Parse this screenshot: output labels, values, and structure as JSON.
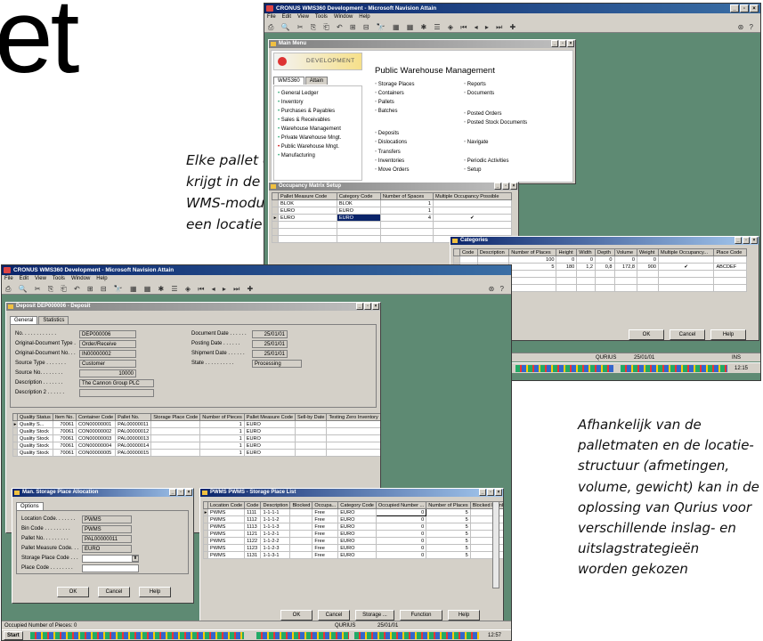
{
  "headline": "et",
  "caption_left": {
    "lines": [
      "Elke pallet en/of container",
      "krijgt in de aanvullende",
      "WMS-module automatisch",
      "een locatie toegewezen"
    ]
  },
  "caption_right": {
    "lines": [
      "Afhankelijk van de",
      "palletmaten en de locatie-",
      "structuur (afmetingen,",
      "volume, gewicht) kan in de",
      "oplossing van Qurius voor",
      "verschillende inslag- en",
      "uitslagstrategieën",
      "worden gekozen"
    ]
  },
  "app": {
    "title": "CRONUS WMS360 Development - Microsoft Navision Attain",
    "menu": [
      "File",
      "Edit",
      "View",
      "Tools",
      "Window",
      "Help"
    ],
    "toolbar_glyphs": "⎙ 🔍  ✂ ⎘ ⎗  ↶ ⊞ ⊟ 🔭 ▦ ▦ ✱ ☰  ◈  ⏮ ◂ ▸ ⏭ ✚",
    "toolbar_right": "⊛ ?"
  },
  "main_menu": {
    "title": "Main Menu",
    "banner": "DEVELOPMENT",
    "tabs": [
      "WMS360",
      "Attain"
    ],
    "nav": [
      "General Ledger",
      "Inventory",
      "Purchases & Payables",
      "Sales & Receivables",
      "Warehouse Management",
      "Private Warehouse Mngt.",
      "Public Warehouse Mngt.",
      "Manufacturing"
    ],
    "heading": "Public Warehouse Management",
    "col1": [
      "Storage Places",
      "Containers",
      "Pallets",
      "Batches",
      "Deposits",
      "Dislocations",
      "Transfers",
      "Inventories",
      "Move Orders"
    ],
    "col2": [
      "Reports",
      "Documents",
      "Posted Orders",
      "Posted Stock Documents",
      "Navigate",
      "Periodic Activities",
      "Setup"
    ]
  },
  "occupancy": {
    "title": "Occupancy Matrix Setup",
    "headers": [
      "Pallet Measure Code",
      "Category Code",
      "Number of Spaces",
      "Multiple Occupancy Possible"
    ],
    "rows": [
      [
        "BLOK",
        "BLOK",
        "1",
        ""
      ],
      [
        "EURO",
        "EURO",
        "1",
        ""
      ],
      [
        "EURO",
        "EURO",
        "4",
        "✔"
      ]
    ]
  },
  "categories": {
    "title": "Categories",
    "headers": [
      "Code",
      "Description",
      "Number of Places",
      "Height",
      "Width",
      "Depth",
      "Volume",
      "Weight",
      "Multiple Occupancy...",
      "Place Code"
    ],
    "rows": [
      [
        "",
        "",
        "100",
        "0",
        "0",
        "0",
        "0",
        "0",
        "",
        ""
      ],
      [
        "",
        "",
        "5",
        "180",
        "1,2",
        "0,8",
        "172,8",
        "900",
        "✔",
        "ABCDEF"
      ]
    ],
    "ok": "OK",
    "cancel": "Cancel",
    "help": "Help"
  },
  "back_status": {
    "company": "QURIUS",
    "date": "25/01/01",
    "ins": "INS",
    "clock": "12:15"
  },
  "deposit": {
    "title": "Deposit DEP000006 - Deposit",
    "tabs": [
      "General",
      "Statistics"
    ],
    "left_fields": [
      {
        "label": "No. . . . . . . . . . . .",
        "value": "DEP000006"
      },
      {
        "label": "Original-Document Type .",
        "value": "Order/Receive"
      },
      {
        "label": "Original-Document No. . .",
        "value": "IN00000002"
      },
      {
        "label": "Source Type . . . . . . .",
        "value": "Customer"
      },
      {
        "label": "Source No. . . . . . . .",
        "value": "10000"
      },
      {
        "label": "Description . . . . . . .",
        "value": "The Cannon Group PLC"
      },
      {
        "label": "Description 2 . . . . . .",
        "value": ""
      }
    ],
    "right_fields": [
      {
        "label": "Document Date . . . . . .",
        "value": "25/01/01"
      },
      {
        "label": "Posting Date . . . . . .",
        "value": "25/01/01"
      },
      {
        "label": "Shipment Date . . . . . .",
        "value": "25/01/01"
      },
      {
        "label": "State . . . . . . . . . .",
        "value": "Processing"
      }
    ],
    "line_headers": [
      "Quality Status",
      "Item No.",
      "Container Code",
      "Pallet No.",
      "Storage Place Code",
      "Number of Pieces",
      "Pallet Measure Code",
      "Sell-by Date",
      "Testing Zero Inventory"
    ],
    "lines": [
      [
        "Quality S...",
        "70061",
        "CON00000001",
        "PAL00000011",
        "",
        "1",
        "EURO",
        "",
        ""
      ],
      [
        "Quality Stock",
        "70061",
        "CON00000002",
        "PAL00000012",
        "",
        "1",
        "EURO",
        "",
        ""
      ],
      [
        "Quality Stock",
        "70061",
        "CON00000003",
        "PAL00000013",
        "",
        "1",
        "EURO",
        "",
        ""
      ],
      [
        "Quality Stock",
        "70061",
        "CON00000004",
        "PAL00000014",
        "",
        "1",
        "EURO",
        "",
        ""
      ],
      [
        "Quality Stock",
        "70061",
        "CON00000005",
        "PAL00000015",
        "",
        "1",
        "EURO",
        "",
        ""
      ]
    ]
  },
  "man_storage": {
    "title": "Man. Storage Place Allocation",
    "tab": "Options",
    "fields": [
      {
        "label": "Location Code. . . . . . .",
        "value": "PWMS"
      },
      {
        "label": "Bin Code . . . . . . . . .",
        "value": "PWMS"
      },
      {
        "label": "Pallet No. . . . . . . . .",
        "value": "PAL00000011"
      },
      {
        "label": "Pallet Measure Code. . .",
        "value": "EURO"
      },
      {
        "label": "Storage Place Code . . .",
        "value": ""
      },
      {
        "label": "Place Code . . . . . . . .",
        "value": ""
      }
    ],
    "ok": "OK",
    "cancel": "Cancel",
    "help": "Help"
  },
  "storage_list": {
    "title": "PWMS PWMS - Storage Place List",
    "headers": [
      "Location Code",
      "Code",
      "Description",
      "Blocked",
      "Occupa...",
      "Category Code",
      "Occupied Number ...",
      "Number of Places",
      "Blocked Number ..."
    ],
    "rows": [
      [
        "PWMS",
        "1111",
        "1-1-1-1",
        "",
        "Free",
        "EURO",
        "0",
        "5",
        ""
      ],
      [
        "PWMS",
        "1112",
        "1-1-1-2",
        "",
        "Free",
        "EURO",
        "0",
        "5",
        ""
      ],
      [
        "PWMS",
        "1113",
        "1-1-1-3",
        "",
        "Free",
        "EURO",
        "0",
        "5",
        ""
      ],
      [
        "PWMS",
        "1121",
        "1-1-2-1",
        "",
        "Free",
        "EURO",
        "0",
        "5",
        ""
      ],
      [
        "PWMS",
        "1122",
        "1-1-2-2",
        "",
        "Free",
        "EURO",
        "0",
        "5",
        ""
      ],
      [
        "PWMS",
        "1123",
        "1-1-2-3",
        "",
        "Free",
        "EURO",
        "0",
        "5",
        ""
      ],
      [
        "PWMS",
        "1131",
        "1-1-3-1",
        "",
        "Free",
        "EURO",
        "0",
        "5",
        ""
      ]
    ],
    "ok": "OK",
    "cancel": "Cancel",
    "storage": "Storage ...",
    "function": "Function",
    "help": "Help"
  },
  "front_status": {
    "text": "Occupied Number of Pieces: 0",
    "company": "QURIUS",
    "date": "25/01/01"
  },
  "taskbar": {
    "start": "Start",
    "clock": "12:57"
  },
  "colors": {
    "desktop": "#5e8a73",
    "title_active": "#0a246a",
    "face": "#d4d0c8"
  }
}
